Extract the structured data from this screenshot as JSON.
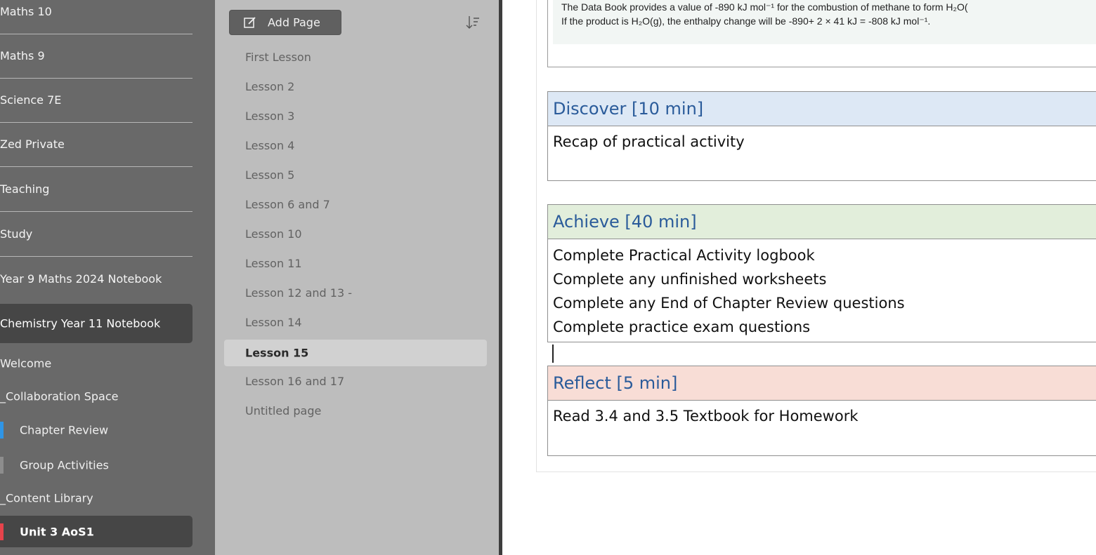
{
  "notebooks": {
    "items": [
      {
        "label": "Maths 10"
      },
      {
        "label": "Maths 9"
      },
      {
        "label": "Science 7E"
      },
      {
        "label": "Zed Private"
      },
      {
        "label": "Teaching"
      },
      {
        "label": "Study"
      },
      {
        "label": "Year 9 Maths 2024 Notebook"
      }
    ],
    "active": {
      "label": "Chemistry Year 11 Notebook"
    }
  },
  "sections": {
    "items": [
      {
        "label": "Welcome"
      },
      {
        "label": "_Collaboration Space"
      },
      {
        "label": "Chapter Review",
        "color": "#2f95e6"
      },
      {
        "label": "Group Activities",
        "color": "#8d8d8d"
      },
      {
        "label": "_Content Library"
      }
    ],
    "active": {
      "label": "Unit 3 AoS1",
      "color": "#e6434b"
    }
  },
  "pages": {
    "add_label": "Add Page",
    "items": [
      {
        "label": "First Lesson"
      },
      {
        "label": "Lesson 2"
      },
      {
        "label": "Lesson 3"
      },
      {
        "label": "Lesson 4"
      },
      {
        "label": "Lesson 5"
      },
      {
        "label": "Lesson 6 and 7"
      },
      {
        "label": "Lesson 10"
      },
      {
        "label": "Lesson 11"
      },
      {
        "label": "Lesson 12 and 13 -"
      },
      {
        "label": "Lesson 14"
      },
      {
        "label": "Lesson 15"
      },
      {
        "label": "Lesson 16 and 17"
      },
      {
        "label": "Untitled page"
      }
    ],
    "active_label": "Lesson 15"
  },
  "content": {
    "formula": {
      "line1": "The Data Book provides a value of -890 kJ mol⁻¹ for the combustion of methane to form H₂O(",
      "line2": "If the product is H₂O(g), the enthalpy change will be -890+ 2 × 41 kJ = -808 kJ mol⁻¹."
    },
    "discover": {
      "title": "Discover [10 min]",
      "lines": [
        "Recap of practical activity"
      ],
      "color": "#dde8f5"
    },
    "achieve": {
      "title": "Achieve [40 min]",
      "lines": [
        "Complete Practical Activity logbook",
        "Complete any unfinished worksheets",
        "Complete any End of Chapter Review questions",
        "Complete practice exam questions"
      ],
      "color": "#e2eedb"
    },
    "reflect": {
      "title": "Reflect [5 min]",
      "lines": [
        "Read 3.4 and 3.5 Textbook for Homework"
      ],
      "color": "#f8ddd6"
    }
  }
}
